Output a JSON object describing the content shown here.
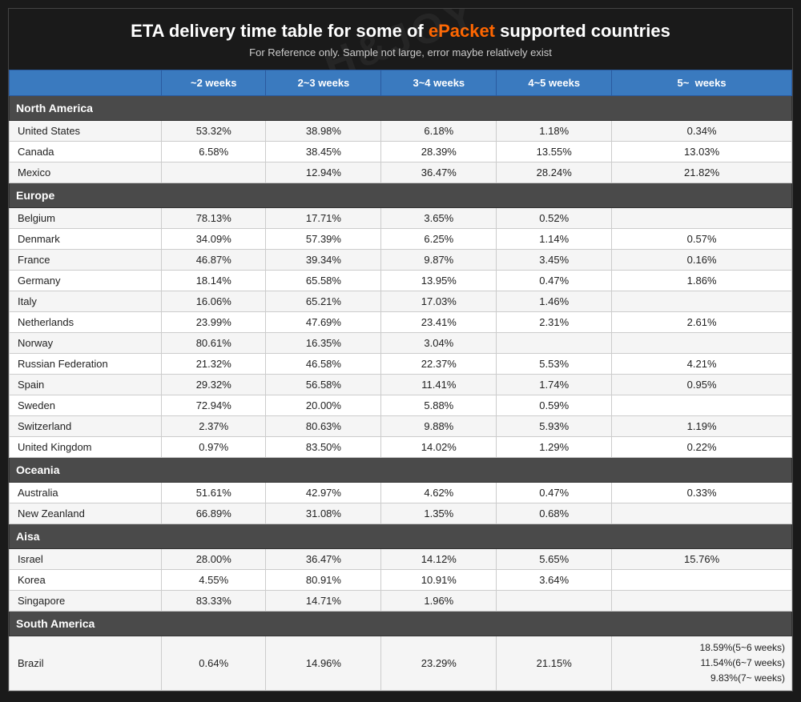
{
  "title": {
    "main_prefix": "ETA delivery time table for some of ",
    "highlight": "ePacket",
    "main_suffix": " supported countries",
    "subtitle": "For Reference only. Sample not large, error maybe relatively exist"
  },
  "watermark": "H&JOY",
  "columns": [
    "",
    "~2 weeks",
    "2~3 weeks",
    "3~4 weeks",
    "4~5 weeks",
    "5~  weeks"
  ],
  "sections": [
    {
      "name": "North America",
      "rows": [
        [
          "United States",
          "53.32%",
          "38.98%",
          "6.18%",
          "1.18%",
          "0.34%"
        ],
        [
          "Canada",
          "6.58%",
          "38.45%",
          "28.39%",
          "13.55%",
          "13.03%"
        ],
        [
          "Mexico",
          "",
          "12.94%",
          "36.47%",
          "28.24%",
          "21.82%"
        ]
      ]
    },
    {
      "name": "Europe",
      "rows": [
        [
          "Belgium",
          "78.13%",
          "17.71%",
          "3.65%",
          "0.52%",
          ""
        ],
        [
          "Denmark",
          "34.09%",
          "57.39%",
          "6.25%",
          "1.14%",
          "0.57%"
        ],
        [
          "France",
          "46.87%",
          "39.34%",
          "9.87%",
          "3.45%",
          "0.16%"
        ],
        [
          "Germany",
          "18.14%",
          "65.58%",
          "13.95%",
          "0.47%",
          "1.86%"
        ],
        [
          "Italy",
          "16.06%",
          "65.21%",
          "17.03%",
          "1.46%",
          ""
        ],
        [
          "Netherlands",
          "23.99%",
          "47.69%",
          "23.41%",
          "2.31%",
          "2.61%"
        ],
        [
          "Norway",
          "80.61%",
          "16.35%",
          "3.04%",
          "",
          ""
        ],
        [
          "Russian Federation",
          "21.32%",
          "46.58%",
          "22.37%",
          "5.53%",
          "4.21%"
        ],
        [
          "Spain",
          "29.32%",
          "56.58%",
          "11.41%",
          "1.74%",
          "0.95%"
        ],
        [
          "Sweden",
          "72.94%",
          "20.00%",
          "5.88%",
          "0.59%",
          ""
        ],
        [
          "Switzerland",
          "2.37%",
          "80.63%",
          "9.88%",
          "5.93%",
          "1.19%"
        ],
        [
          "United Kingdom",
          "0.97%",
          "83.50%",
          "14.02%",
          "1.29%",
          "0.22%"
        ]
      ]
    },
    {
      "name": "Oceania",
      "rows": [
        [
          "Australia",
          "51.61%",
          "42.97%",
          "4.62%",
          "0.47%",
          "0.33%"
        ],
        [
          "New Zeanland",
          "66.89%",
          "31.08%",
          "1.35%",
          "0.68%",
          ""
        ]
      ]
    },
    {
      "name": "Aisa",
      "rows": [
        [
          "Israel",
          "28.00%",
          "36.47%",
          "14.12%",
          "5.65%",
          "15.76%"
        ],
        [
          "Korea",
          "4.55%",
          "80.91%",
          "10.91%",
          "3.64%",
          ""
        ],
        [
          "Singapore",
          "83.33%",
          "14.71%",
          "1.96%",
          "",
          ""
        ]
      ]
    },
    {
      "name": "South America",
      "rows": [
        [
          "Brazil",
          "0.64%",
          "14.96%",
          "23.29%",
          "21.15%",
          "18.59%(5~6 weeks)\n11.54%(6~7 weeks)\n9.83%(7~ weeks)"
        ]
      ]
    }
  ]
}
